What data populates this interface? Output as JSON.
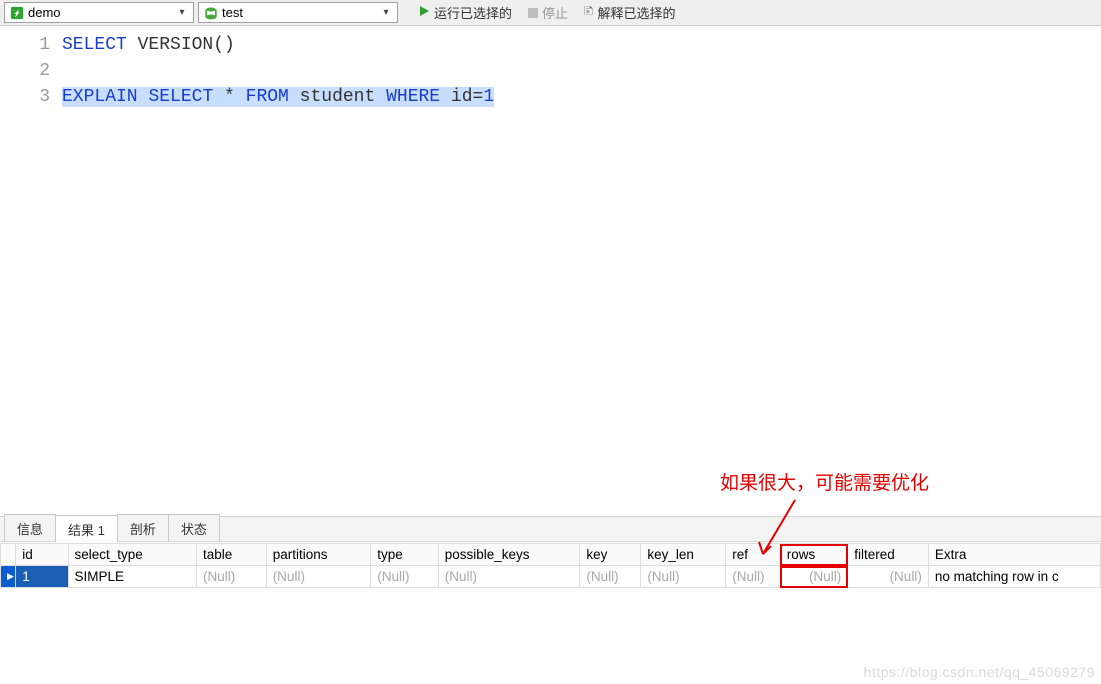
{
  "toolbar": {
    "connection": "demo",
    "database": "test",
    "run": "运行已选择的",
    "stop": "停止",
    "explain": "解释已选择的"
  },
  "editor": {
    "lines": [
      {
        "n": "1",
        "tokens": [
          {
            "t": "SELECT",
            "c": "kw"
          },
          {
            "t": " ",
            "c": ""
          },
          {
            "t": "VERSION",
            "c": "id"
          },
          {
            "t": "()",
            "c": "id"
          }
        ],
        "selected": false
      },
      {
        "n": "2",
        "tokens": [],
        "selected": false
      },
      {
        "n": "3",
        "tokens": [
          {
            "t": "EXPLAIN",
            "c": "kw"
          },
          {
            "t": " ",
            "c": ""
          },
          {
            "t": "SELECT",
            "c": "kw"
          },
          {
            "t": " * ",
            "c": "id"
          },
          {
            "t": "FROM",
            "c": "kw"
          },
          {
            "t": " student ",
            "c": "id"
          },
          {
            "t": "WHERE",
            "c": "kw"
          },
          {
            "t": " id=",
            "c": "id"
          },
          {
            "t": "1",
            "c": "num"
          }
        ],
        "selected": true
      }
    ]
  },
  "annotation": "如果很大，可能需要优化",
  "tabs": {
    "info": "信息",
    "result1": "结果 1",
    "profile": "剖析",
    "status": "状态"
  },
  "grid": {
    "headers": [
      "id",
      "select_type",
      "table",
      "partitions",
      "type",
      "possible_keys",
      "key",
      "key_len",
      "ref",
      "rows",
      "filtered",
      "Extra"
    ],
    "row": {
      "id": "1",
      "select_type": "SIMPLE",
      "table": "(Null)",
      "partitions": "(Null)",
      "type": "(Null)",
      "possible_keys": "(Null)",
      "key": "(Null)",
      "key_len": "(Null)",
      "ref": "(Null)",
      "rows": "(Null)",
      "filtered": "(Null)",
      "Extra": "no matching row in c"
    },
    "highlight_col": "rows"
  },
  "watermark": "https://blog.csdn.net/qq_45069279"
}
